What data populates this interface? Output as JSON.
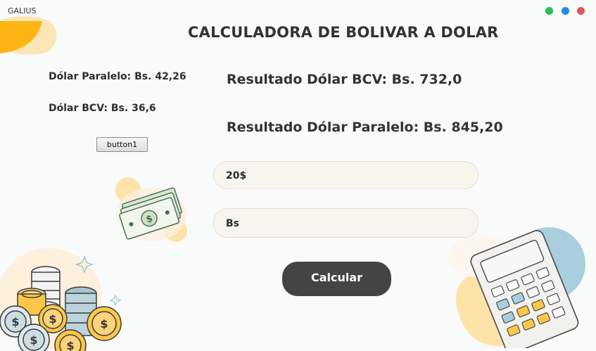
{
  "window": {
    "app_name": "GALIUS"
  },
  "header": {
    "title": "CALCULADORA DE BOLIVAR A DOLAR"
  },
  "rates": {
    "paralelo": "Dólar Paralelo: Bs. 42,26",
    "bcv": "Dólar BCV: Bs. 36,6"
  },
  "results": {
    "bcv": "Resultado Dólar BCV: Bs. 732,0",
    "paralelo": "Resultado Dólar Paralelo: Bs. 845,20"
  },
  "controls": {
    "button1_label": "button1",
    "usd_value": "20$",
    "bs_value": "Bs",
    "calcular_label": "Calcular"
  },
  "colors": {
    "title_green": "#27c04c",
    "title_blue": "#1f8ce6",
    "title_red": "#ee5253",
    "calc_button": "#444444",
    "accent_yellow": "#fcc748"
  },
  "icons": [
    "window-control-dots",
    "banknotes-illustration",
    "coins-illustration",
    "calculator-illustration",
    "sparkle-icon"
  ]
}
